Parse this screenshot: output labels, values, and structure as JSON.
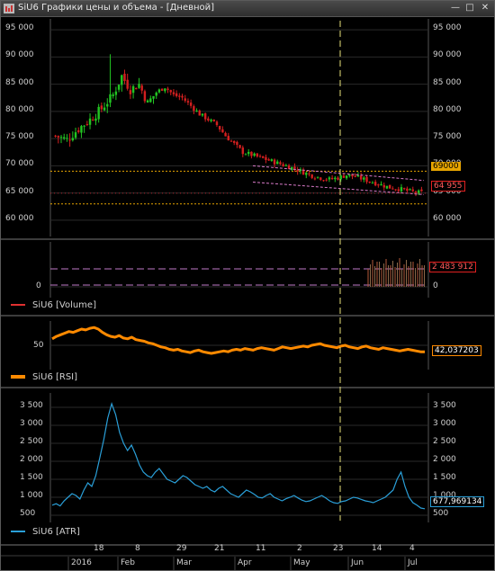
{
  "window": {
    "title": "SiU6 Графики цены и объема - [Дневной]",
    "buttons": {
      "minimize": "—",
      "maximize": "□",
      "close": "✕"
    }
  },
  "colors": {
    "bg": "#000000",
    "grid": "#2a2a2a",
    "axis_text": "#d0d0d0",
    "candle_up": "#22c422",
    "candle_down": "#d21f1f",
    "level_orange": "#e6a400",
    "trend_pink": "#d87ac8",
    "rsi_line": "#ff8a00",
    "atr_line": "#2a9fd8",
    "volume_line": "#e03030",
    "vline": "#e8e27a"
  },
  "price_panel": {
    "y_ticks": [
      "95 000",
      "90 000",
      "85 000",
      "80 000",
      "75 000",
      "70 000",
      "65 000",
      "60 000"
    ],
    "level_label": "69000",
    "last_price_label": "64 955"
  },
  "volume_panel": {
    "legend": "SiU6 [Volume]",
    "y_ticks": [
      "0"
    ],
    "last_value_label": "2 483 912"
  },
  "rsi_panel": {
    "legend": "SiU6 [RSI]",
    "y_ticks": [
      "50"
    ],
    "last_value_label": "42,037203"
  },
  "atr_panel": {
    "legend": "SiU6 [ATR]",
    "y_ticks": [
      "3 500",
      "3 000",
      "2 500",
      "2 000",
      "1 500",
      "1 000",
      "500"
    ],
    "last_value_label": "677,969134"
  },
  "time_axis": {
    "day_labels": [
      "18",
      "8",
      "29",
      "21",
      "11",
      "2",
      "23",
      "14",
      "4"
    ],
    "month_labels": [
      "2016",
      "Feb",
      "Mar",
      "Apr",
      "May",
      "Jun",
      "Jul"
    ]
  },
  "chart_data": [
    {
      "type": "candlestick",
      "series_name": "SiU6",
      "ylim": [
        57000,
        97000
      ],
      "horizontal_levels": [
        69000,
        63000
      ],
      "last_price": 64955,
      "close_path": [
        [
          0,
          75500
        ],
        [
          4,
          74800
        ],
        [
          8,
          76800
        ],
        [
          12,
          78500
        ],
        [
          16,
          80500
        ],
        [
          20,
          83000
        ],
        [
          23,
          86500
        ],
        [
          26,
          84000
        ],
        [
          29,
          85000
        ],
        [
          32,
          81500
        ],
        [
          35,
          83500
        ],
        [
          38,
          84500
        ],
        [
          41,
          83000
        ],
        [
          44,
          82500
        ],
        [
          47,
          81000
        ],
        [
          50,
          79500
        ],
        [
          53,
          78500
        ],
        [
          56,
          77500
        ],
        [
          59,
          75500
        ],
        [
          62,
          74000
        ],
        [
          65,
          72500
        ],
        [
          68,
          72000
        ],
        [
          71,
          71500
        ],
        [
          74,
          71000
        ],
        [
          77,
          70500
        ],
        [
          80,
          70000
        ],
        [
          83,
          69500
        ],
        [
          86,
          68800
        ],
        [
          89,
          68200
        ],
        [
          92,
          67800
        ],
        [
          95,
          67500
        ],
        [
          98,
          67800
        ],
        [
          101,
          68300
        ],
        [
          104,
          68000
        ],
        [
          107,
          67500
        ],
        [
          110,
          67000
        ],
        [
          113,
          66500
        ],
        [
          116,
          66000
        ],
        [
          119,
          65800
        ],
        [
          122,
          65400
        ],
        [
          125,
          65100
        ],
        [
          128,
          65000
        ]
      ]
    },
    {
      "type": "bar",
      "series_name": "SiU6 [Volume]",
      "last_value": 2483912
    },
    {
      "type": "line",
      "series_name": "SiU6 [RSI]",
      "ylim": [
        20,
        80
      ],
      "values": [
        58,
        61,
        63,
        65,
        67,
        66,
        68,
        70,
        69,
        71,
        72,
        70,
        66,
        63,
        61,
        60,
        62,
        59,
        58,
        60,
        57,
        56,
        55,
        53,
        52,
        50,
        48,
        47,
        45,
        44,
        45,
        43,
        42,
        41,
        43,
        44,
        42,
        41,
        40,
        41,
        42,
        43,
        42,
        44,
        45,
        44,
        46,
        45,
        44,
        46,
        47,
        46,
        45,
        44,
        46,
        48,
        47,
        46,
        47,
        48,
        49,
        48,
        50,
        51,
        52,
        50,
        49,
        48,
        47,
        49,
        50,
        48,
        47,
        46,
        48,
        49,
        47,
        46,
        45,
        47,
        46,
        45,
        44,
        43,
        44,
        45,
        44,
        43,
        42,
        42
      ],
      "last_value": 42.037203
    },
    {
      "type": "line",
      "series_name": "SiU6 [ATR]",
      "ylim": [
        300,
        3900
      ],
      "values": [
        780,
        820,
        760,
        900,
        1000,
        1100,
        1050,
        950,
        1200,
        1400,
        1300,
        1600,
        2100,
        2600,
        3200,
        3600,
        3300,
        2800,
        2500,
        2300,
        2450,
        2200,
        1900,
        1700,
        1600,
        1550,
        1700,
        1800,
        1650,
        1500,
        1450,
        1400,
        1500,
        1600,
        1550,
        1450,
        1350,
        1300,
        1250,
        1300,
        1200,
        1150,
        1250,
        1300,
        1200,
        1100,
        1050,
        1000,
        1100,
        1200,
        1150,
        1080,
        1000,
        980,
        1050,
        1100,
        1000,
        950,
        900,
        960,
        1000,
        1050,
        980,
        920,
        880,
        900,
        950,
        1000,
        1050,
        980,
        900,
        850,
        830,
        880,
        900,
        950,
        1000,
        980,
        940,
        900,
        880,
        850,
        900,
        950,
        1000,
        1100,
        1200,
        1500,
        1700,
        1300,
        1000,
        850,
        780,
        700,
        680
      ],
      "last_value": 677.969134
    }
  ]
}
